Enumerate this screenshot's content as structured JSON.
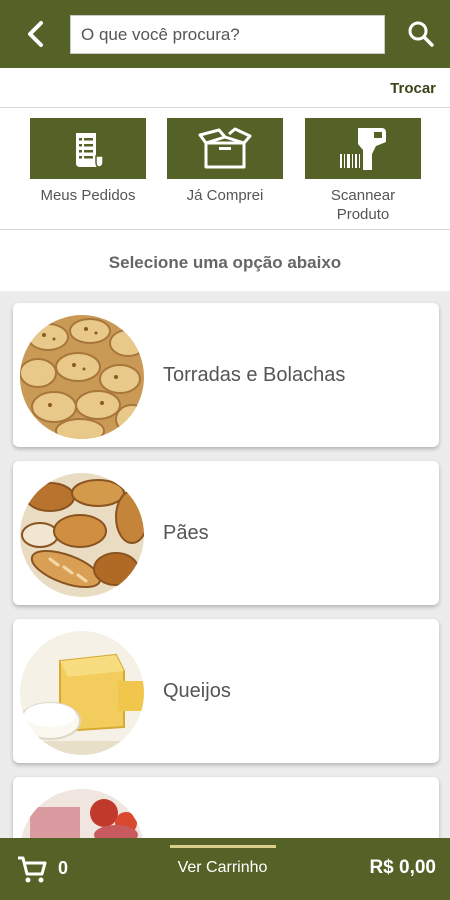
{
  "header": {
    "back_icon": "chevron-left-icon",
    "search_placeholder": "O que você procura?",
    "search_icon": "search-icon",
    "accent_color": "#556227"
  },
  "trocar_label": "Trocar",
  "actions": [
    {
      "label": "Meus Pedidos",
      "icon": "receipt-icon"
    },
    {
      "label": "Já Comprei",
      "icon": "open-box-icon"
    },
    {
      "label": "Scannear Produto",
      "icon": "barcode-scanner-icon"
    }
  ],
  "select_prompt": "Selecione uma opção abaixo",
  "categories": [
    {
      "label": "Torradas e Bolachas",
      "image": "toast-crackers-photo"
    },
    {
      "label": "Pães",
      "image": "breads-photo"
    },
    {
      "label": "Queijos",
      "image": "cheeses-photo"
    },
    {
      "label": "",
      "image": "cold-cuts-photo"
    }
  ],
  "cart": {
    "icon": "cart-icon",
    "count": "0",
    "view_label": "Ver Carrinho",
    "total": "R$ 0,00"
  }
}
